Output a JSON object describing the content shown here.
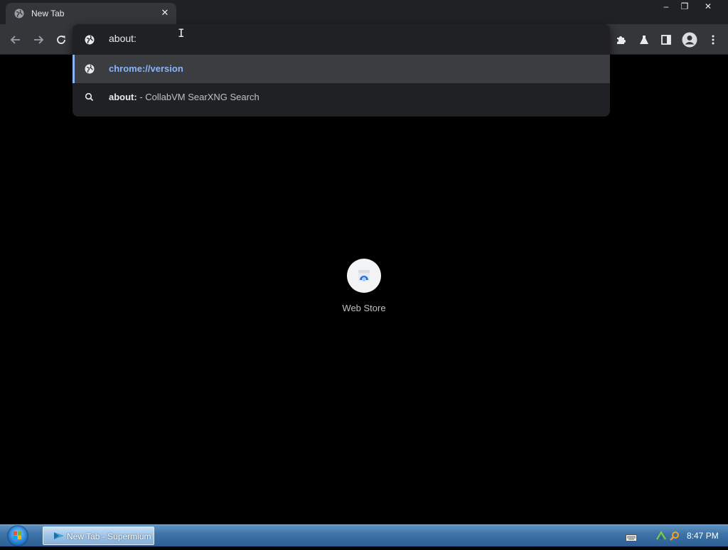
{
  "tab": {
    "title": "New Tab",
    "close": "✕"
  },
  "window_controls": {
    "minimize": "–",
    "restore": "❐",
    "close": "✕"
  },
  "omnibox": {
    "input_text": "about:",
    "suggestions": [
      {
        "type": "url",
        "text": "chrome://version",
        "selected": true
      },
      {
        "type": "search",
        "query": "about:",
        "suffix": " - CollabVM SearXNG Search"
      }
    ]
  },
  "shortcuts": [
    {
      "label": "Web Store"
    }
  ],
  "taskbar": {
    "window_button_label": "New Tab - Supermium",
    "clock": "8:47 PM"
  },
  "colors": {
    "accent": "#8ab4f8",
    "page_bg": "#000000",
    "toolbar_bg": "#35363a"
  }
}
